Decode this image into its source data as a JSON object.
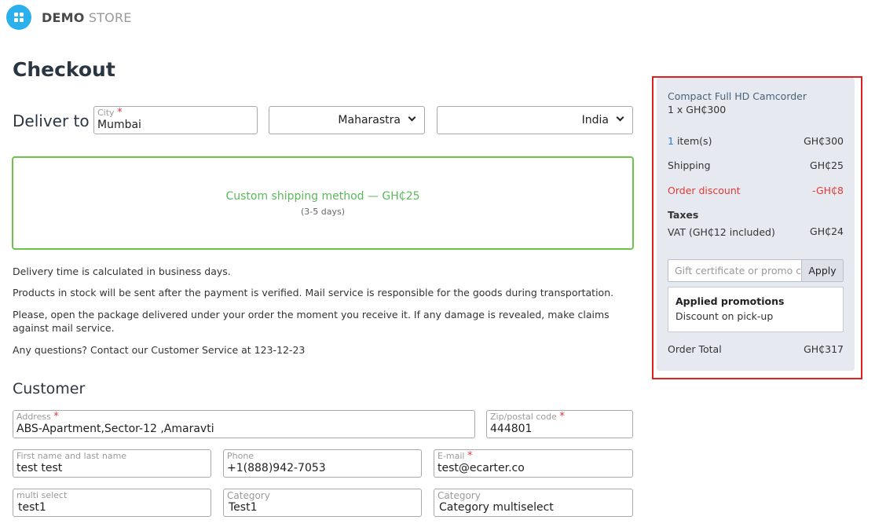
{
  "header": {
    "brand_bold": "DEMO",
    "brand_light": "STORE"
  },
  "page_title": "Checkout",
  "deliver": {
    "label": "Deliver to",
    "city_label": "City",
    "city_value": "Mumbai",
    "state_value": "Maharastra",
    "country_value": "India"
  },
  "shipping": {
    "name": "Custom shipping method — GH₵25",
    "days": "(3-5 days)"
  },
  "info": [
    "Delivery time is calculated in business days.",
    "Products in stock will be sent after the payment is verified. Mail service is responsible for the goods during transportation.",
    "Please, open the package delivered under your order the moment you receive it. If any damage is revealed, make claims against mail service.",
    "Any questions? Contact our Customer Service at 123-12-23"
  ],
  "customer": {
    "title": "Customer",
    "address_label": "Address",
    "address_value": "ABS-Apartment,Sector-12 ,Amaravti",
    "zip_label": "Zip/postal code",
    "zip_value": "444801",
    "name_label": "First name and last name",
    "name_value": "test test",
    "phone_label": "Phone",
    "phone_value": "+1(888)942-7053",
    "email_label": "E-mail",
    "email_value": "test@ecarter.co",
    "multi_label": "multi select",
    "multi_value": "test1",
    "cat1_label": "Category",
    "cat1_value": "Test1",
    "cat2_label": "Category",
    "cat2_value": "Category multiselect"
  },
  "summary": {
    "product_name": "Compact Full HD Camcorder",
    "product_qty": "1 x GH₵300",
    "items_count": "1",
    "items_label": "item(s)",
    "items_value": "GH₵300",
    "shipping_label": "Shipping",
    "shipping_value": "GH₵25",
    "discount_label": "Order discount",
    "discount_value": "-GH₵8",
    "taxes_label": "Taxes",
    "vat_label": "VAT (GH₵12 included)",
    "vat_value": "GH₵24",
    "promo_placeholder": "Gift certificate or promo code",
    "apply_label": "Apply",
    "applied_title": "Applied promotions",
    "applied_item": "Discount on pick-up",
    "total_label": "Order Total",
    "total_value": "GH₵317"
  },
  "colors": {
    "accent": "#2bb0ed",
    "success": "#6cc24a",
    "danger": "#e53935",
    "highlight": "#e0201e"
  }
}
